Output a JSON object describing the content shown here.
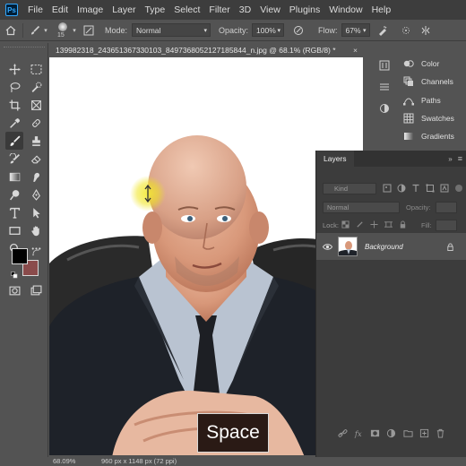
{
  "app": {
    "logo": "Ps"
  },
  "menu": [
    "File",
    "Edit",
    "Image",
    "Layer",
    "Type",
    "Select",
    "Filter",
    "3D",
    "View",
    "Plugins",
    "Window",
    "Help"
  ],
  "options_bar": {
    "brush_size": "15",
    "mode_label": "Mode:",
    "mode_value": "Normal",
    "opacity_label": "Opacity:",
    "opacity_value": "100%",
    "flow_label": "Flow:",
    "flow_value": "67%"
  },
  "document": {
    "tab_title": "139982318_243651367330103_8497368052127185844_n.jpg @ 68.1% (RGB/8) *",
    "close_glyph": "×",
    "zoom": "68.09%",
    "dimensions": "960 px x 1148 px (72 ppi)"
  },
  "right_panels": [
    {
      "label": "Color",
      "icon": "color-wheel-icon"
    },
    {
      "label": "Channels",
      "icon": "channels-icon"
    },
    {
      "label": "Paths",
      "icon": "paths-icon"
    },
    {
      "label": "Swatches",
      "icon": "swatches-icon"
    },
    {
      "label": "Gradients",
      "icon": "gradients-icon"
    }
  ],
  "layers_panel": {
    "tab": "Layers",
    "kind_placeholder": "Kind",
    "mode": "Normal",
    "opacity_label": "Opacity:",
    "lock_label": "Lock:",
    "fill_label": "Fill:",
    "layers": [
      {
        "name": "Background",
        "visible": true,
        "locked": true
      }
    ]
  },
  "overlay_key": "Space",
  "colors": {
    "foreground": "#000000",
    "background": "#8a4b4b",
    "brush_cursor": "#f0e41e"
  }
}
